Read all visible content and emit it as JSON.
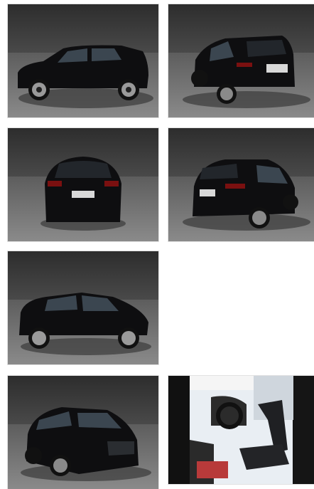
{
  "gallery": {
    "photos": [
      {
        "view": "side-left"
      },
      {
        "view": "rear-quarter-left"
      },
      {
        "view": "rear"
      },
      {
        "view": "rear-quarter-right"
      },
      {
        "view": "side-left-2"
      },
      {
        "view": "front-quarter-left"
      },
      {
        "view": "interior-driver-seat"
      }
    ]
  },
  "colors": {
    "studio_wall": "#3e3e3e",
    "studio_floor": "#6d6d6d",
    "car_body": "#0e0e10",
    "page_background": "#ffffff"
  }
}
